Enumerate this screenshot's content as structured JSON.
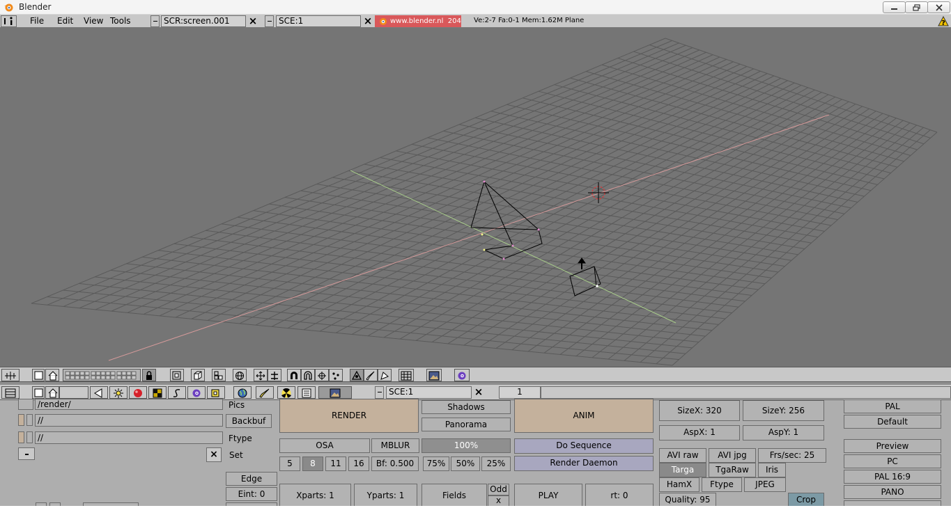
{
  "window": {
    "title": "Blender"
  },
  "topbar": {
    "menus": [
      "File",
      "Edit",
      "View",
      "Tools"
    ],
    "screen_name": "SCR:screen.001",
    "scene_name": "SCE:1",
    "url_label": "www.blender.nl",
    "version": "204",
    "status": "Ve:2-7 Fa:0-1  Mem:1.62M  Plane"
  },
  "buttons_header": {
    "scene_field": "SCE:1",
    "frame_field": "1"
  },
  "render_panel": {
    "paths": {
      "pics_value": "/render/",
      "pics_label": "Pics",
      "backbuf_value": "//",
      "backbuf_label": "Backbuf",
      "ftype_value": "//",
      "ftype_label": "Ftype",
      "set_label": "Set"
    },
    "edge_label": "Edge",
    "eint_label": "Eint: 0",
    "render_label": "RENDER",
    "shadows_label": "Shadows",
    "panorama_label": "Panorama",
    "osa_label": "OSA",
    "mblur_label": "MBLUR",
    "size_percent": "100%",
    "osa_levels": [
      "5",
      "8",
      "11",
      "16"
    ],
    "osa_selected": "8",
    "bf_label": "Bf: 0.500",
    "size_options": [
      "75%",
      "50%",
      "25%"
    ],
    "xparts_label": "Xparts: 1",
    "yparts_label": "Yparts: 1",
    "fields_label": "Fields",
    "odd_label": "Odd",
    "x_label": "x",
    "anim_label": "ANIM",
    "do_sequence_label": "Do Sequence",
    "render_daemon_label": "Render Daemon",
    "play_label": "PLAY",
    "rt_label": "rt: 0",
    "sizex_label": "SizeX: 320",
    "sizey_label": "SizeY: 256",
    "aspx_label": "AspX: 1",
    "aspy_label": "AspY: 1",
    "format_buttons": {
      "avi_raw": "AVI raw",
      "avi_jpg": "AVI jpg",
      "frs_sec": "Frs/sec: 25",
      "targa": "Targa",
      "tgaraw": "TgaRaw",
      "iris": "Iris",
      "hamx": "HamX",
      "ftype": "Ftype",
      "jpeg": "JPEG",
      "quality": "Quality: 95",
      "crop": "Crop"
    },
    "presets": [
      "PAL",
      "Default",
      "Preview",
      "PC",
      "PAL 16:9",
      "PANO"
    ]
  },
  "colors": {
    "viewport_bg": "#757575",
    "grid_line": "#5a5a5a",
    "x_axis": "#d59a9a",
    "y_axis": "#a8cc8a",
    "header_bg": "#c8c8c8",
    "panel_bg": "#aeaeae",
    "render_btn": "#c4b19c",
    "sequence_btn": "#a8a7bf",
    "url_box": "#d9585a"
  },
  "icons": {
    "viewport_header": [
      "grid-view-icon",
      "solid-square-icon",
      "home-icon",
      "layer-buttons-icon",
      "lock-icon",
      "local-view-icon",
      "perspective-icon",
      "camera-view-icon",
      "draw-mode-icon",
      "pivot-icon",
      "manipulator-icon",
      "magnet-icon",
      "proportional-icon",
      "snap-icon",
      "edit-mode-icon",
      "paint-icon",
      "grid-icon",
      "image-icon",
      "blender-icon"
    ],
    "buttons_header": [
      "buttons-window-icon",
      "solid-square-icon",
      "home-icon",
      "view-icon",
      "lamp-icon",
      "material-icon",
      "texture-icon",
      "animation-icon",
      "blender-icon",
      "object-icon",
      "world-icon",
      "paint-icon",
      "radiosity-icon",
      "script-icon",
      "render-icon"
    ]
  }
}
